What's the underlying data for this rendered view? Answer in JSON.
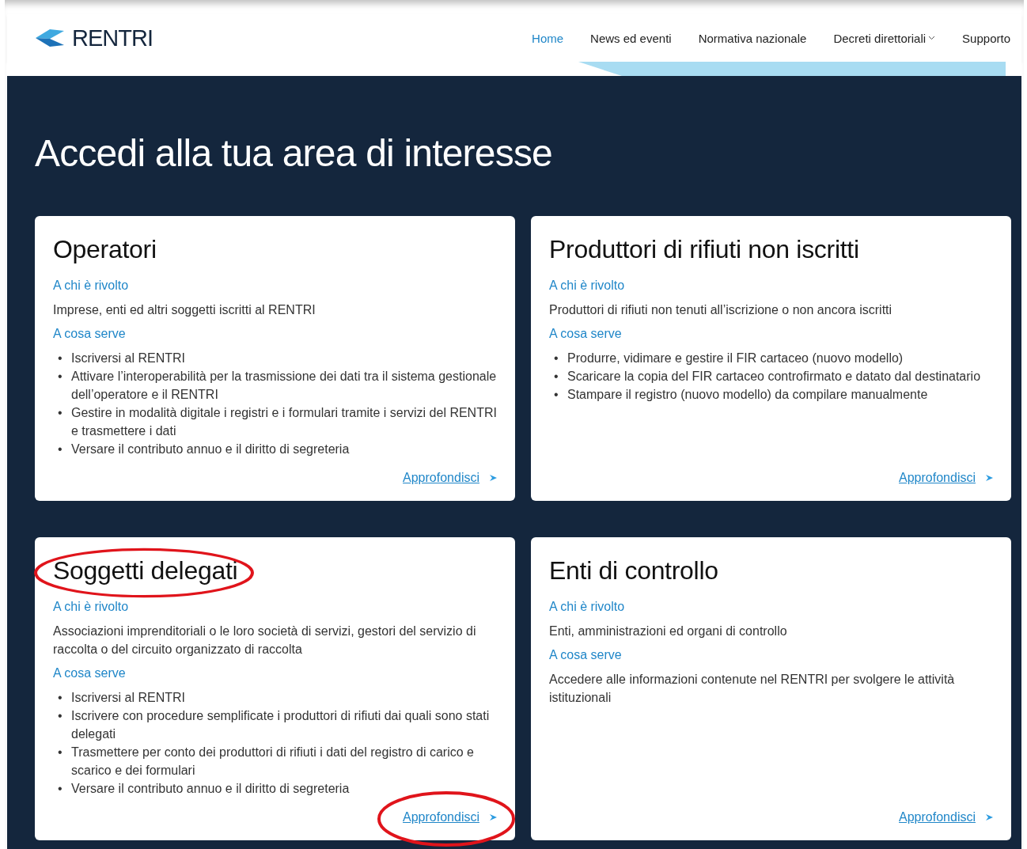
{
  "header": {
    "logo_text": "RENTRI",
    "nav": [
      {
        "label": "Home",
        "selected": true,
        "has_dropdown": false
      },
      {
        "label": "News ed eventi",
        "selected": false,
        "has_dropdown": false
      },
      {
        "label": "Normativa nazionale",
        "selected": false,
        "has_dropdown": false
      },
      {
        "label": "Decreti direttoriali",
        "selected": false,
        "has_dropdown": true
      },
      {
        "label": "Supporto",
        "selected": false,
        "has_dropdown": false
      }
    ]
  },
  "hero": {
    "title": "Accedi alla tua area di interesse"
  },
  "cards": [
    {
      "title": "Operatori",
      "title_circled": false,
      "link": "Approfondisci",
      "link_circled": false,
      "blocks": [
        {
          "kind": "heading",
          "text": "A chi è rivolto"
        },
        {
          "kind": "paragraph",
          "text": "Imprese, enti ed altri soggetti iscritti al RENTRI"
        },
        {
          "kind": "heading",
          "text": "A cosa serve"
        },
        {
          "kind": "bullets",
          "marker": "•",
          "items": [
            "Iscriversi al RENTRI",
            "Attivare l’interoperabilità per la trasmissione dei dati tra il sistema gestionale dell’operatore e il RENTRI",
            "Gestire in modalità digitale i registri e i formulari tramite i servizi del RENTRI e trasmettere i dati",
            "Versare il contributo annuo e il diritto di segreteria"
          ]
        }
      ]
    },
    {
      "title": "Produttori di rifiuti non iscritti",
      "title_circled": false,
      "link": "Approfondisci",
      "link_circled": false,
      "blocks": [
        {
          "kind": "heading",
          "text": "A chi è rivolto"
        },
        {
          "kind": "paragraph",
          "text": "Produttori di rifiuti non tenuti all’iscrizione o non ancora iscritti"
        },
        {
          "kind": "heading",
          "text": "A cosa serve"
        },
        {
          "kind": "bullets",
          "marker": "•",
          "items": [
            "Produrre, vidimare e gestire il FIR cartaceo (nuovo modello)",
            "Scaricare la copia del FIR cartaceo controfirmato e datato dal destinatario",
            "Stampare il registro (nuovo modello) da compilare manualmente"
          ]
        }
      ]
    },
    {
      "title": "Soggetti delegati",
      "title_circled": true,
      "link": "Approfondisci",
      "link_circled": true,
      "blocks": [
        {
          "kind": "heading",
          "text": "A chi è rivolto"
        },
        {
          "kind": "paragraph",
          "text": "Associazioni imprenditoriali o le loro società di servizi, gestori del servizio di raccolta o del circuito organizzato di raccolta"
        },
        {
          "kind": "heading",
          "text": "A cosa serve"
        },
        {
          "kind": "bullets",
          "marker": "•",
          "items": [
            "Iscriversi al RENTRI",
            "Iscrivere con procedure semplificate i produttori di rifiuti dai quali sono stati delegati",
            "Trasmettere per conto dei produttori di rifiuti i dati del registro di carico e scarico e dei formulari",
            "Versare il contributo annuo e il diritto di segreteria"
          ]
        }
      ]
    },
    {
      "title": "Enti di controllo",
      "title_circled": false,
      "link": "Approfondisci",
      "link_circled": false,
      "blocks": [
        {
          "kind": "heading",
          "text": "A chi è rivolto"
        },
        {
          "kind": "paragraph",
          "text": "Enti, amministrazioni ed organi di controllo"
        },
        {
          "kind": "heading",
          "text": "A cosa serve"
        },
        {
          "kind": "paragraph",
          "text": "Accedere alle informazioni contenute nel RENTRI per svolgere le attività istituzionali"
        }
      ]
    }
  ]
}
